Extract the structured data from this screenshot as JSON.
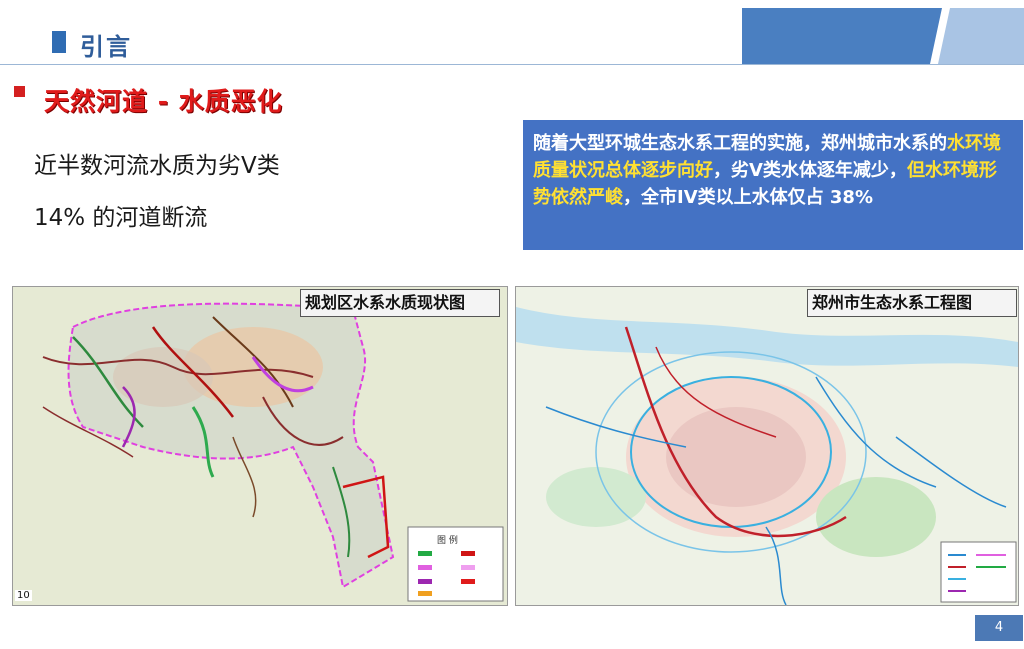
{
  "header": {
    "title": "引言",
    "accent_color": "#2f6cb3"
  },
  "section": {
    "title": "天然河道 - 水质恶化",
    "color": "#e01b1b"
  },
  "points": [
    "近半数河流水质为劣Ⅴ类",
    "14% 的河道断流"
  ],
  "infobox": {
    "part1": "随着大型环城生态水系工程的实施，郑州城市水系的",
    "highlight1": "水环境质量状况总体逐步向好",
    "part2": "，劣Ⅴ类水体逐年减少，",
    "highlight2": "但水环境形势依然严峻",
    "part3": "，全市IV类以上水体仅占 38%",
    "bg_color": "#4472c4",
    "highlight_color": "#ffe032"
  },
  "maps": {
    "left_label": "规划区水系水质现状图",
    "right_label": "郑州市生态水系工程图",
    "left_page_number": "10",
    "legend_title": "图 例"
  },
  "page_number": "4"
}
